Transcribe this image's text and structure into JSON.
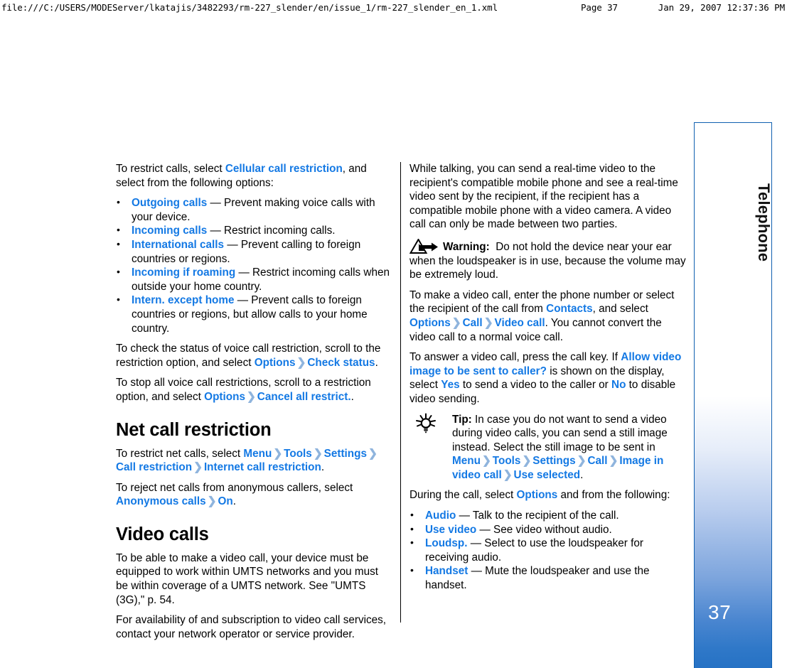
{
  "print_header": {
    "url": "file:///C:/USERS/MODEServer/lkatajis/3482293/rm-227_slender/en/issue_1/rm-227_slender_en_1.xml",
    "page": "Page 37",
    "date": "Jan 29, 2007 12:37:36 PM"
  },
  "sidebar": {
    "chapter": "Telephone",
    "page_number": "37",
    "accent_color": "#1060b0"
  },
  "colors": {
    "link": "#1479e4",
    "separator": "#8fb4dd",
    "text": "#000000"
  },
  "left_column": {
    "intro": {
      "pre": "To restrict calls, select ",
      "link": "Cellular call restriction",
      "post": ", and select from the following options:"
    },
    "options": [
      {
        "term": "Outgoing calls",
        "desc": "— Prevent making voice calls with your device."
      },
      {
        "term": "Incoming calls",
        "desc": "— Restrict incoming calls."
      },
      {
        "term": "International calls",
        "desc": "— Prevent calling to foreign countries or regions."
      },
      {
        "term": "Incoming if roaming",
        "desc": "— Restrict incoming calls when outside your home country."
      },
      {
        "term": "Intern. except home",
        "desc": "— Prevent calls to foreign countries or regions, but allow calls to your home country."
      }
    ],
    "check_status": {
      "pre": "To check the status of voice call restriction, scroll to the restriction option, and select ",
      "path": [
        "Options",
        "Check status"
      ],
      "post": "."
    },
    "cancel_all": {
      "pre": "To stop all voice call restrictions, scroll to a restriction option, and select ",
      "path": [
        "Options",
        "Cancel all restrict."
      ],
      "post": "."
    },
    "net_call_restriction": {
      "heading": "Net call restriction",
      "p1_pre": "To restrict net calls, select ",
      "p1_path": [
        "Menu",
        "Tools",
        "Settings",
        "Call restriction",
        "Internet call restriction"
      ],
      "p1_post": ".",
      "p2_pre": "To reject net calls from anonymous callers, select ",
      "p2_path": [
        "Anonymous calls",
        "On"
      ],
      "p2_post": "."
    },
    "video_calls": {
      "heading": "Video calls",
      "p1": "To be able to make a video call, your device must be equipped to work within UMTS networks and you must be within coverage of a UMTS network. See \"UMTS (3G),\" p. 54.",
      "p2": "For availability of and subscription to video call services, contact your network operator or service provider."
    }
  },
  "right_column": {
    "p_realtime": "While talking, you can send a real-time video to the recipient's compatible mobile phone and see a real-time video sent by the recipient, if the recipient has a compatible mobile phone with a video camera. A video call can only be made between two parties.",
    "warning": {
      "icon": "warning-triangle-arrow-icon",
      "label": "Warning:",
      "text": "Do not hold the device near your ear when the loudspeaker is in use, because the volume may be extremely loud."
    },
    "make_call": {
      "pre": "To make a video call, enter the phone number or select the recipient of the call from ",
      "link1": "Contacts",
      "mid": ", and select ",
      "path": [
        "Options",
        "Call",
        "Video call"
      ],
      "post": ". You cannot convert the video call to a normal voice call."
    },
    "answer_call": {
      "pre": "To answer a video call, press the call key. If ",
      "link1": "Allow video image to be sent to caller?",
      "mid": " is shown on the display, select ",
      "link2": "Yes",
      "mid2": " to send a video to the caller or ",
      "link3": "No",
      "post": " to disable video sending."
    },
    "tip": {
      "icon": "lightbulb-tip-icon",
      "label": "Tip:",
      "text_pre": "In case you do not want to send a video during video calls, you can send a still image instead. Select the still image to be sent in ",
      "path": [
        "Menu",
        "Tools",
        "Settings",
        "Call",
        "Image in video call",
        "Use selected"
      ],
      "text_post": "."
    },
    "during_call": {
      "pre": "During the call, select ",
      "link": "Options",
      "post": " and from the following:"
    },
    "during_call_options": [
      {
        "term": "Audio",
        "desc": "— Talk to the recipient of the call."
      },
      {
        "term": "Use video",
        "desc": "— See video without audio."
      },
      {
        "term": "Loudsp.",
        "desc": "— Select to use the loudspeaker for receiving audio."
      },
      {
        "term": "Handset",
        "desc": "— Mute the loudspeaker and use the handset."
      }
    ]
  }
}
